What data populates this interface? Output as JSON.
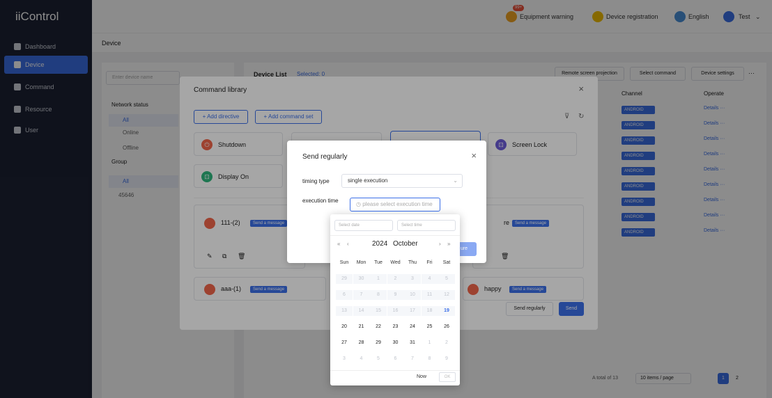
{
  "app": {
    "logo": "iiControl"
  },
  "sidebar": {
    "items": [
      {
        "label": "Dashboard"
      },
      {
        "label": "Device"
      },
      {
        "label": "Command"
      },
      {
        "label": "Resource"
      },
      {
        "label": "User"
      }
    ]
  },
  "topbar": {
    "warning_badge": "99+",
    "equipment_warning": "Equipment warning",
    "device_registration": "Device registration",
    "language": "English",
    "user": "Test"
  },
  "breadcrumb": "Device",
  "left_panel": {
    "search_placeholder": "Enter device name",
    "network_status_title": "Network status",
    "network_options": [
      "All",
      "Online",
      "Offline"
    ],
    "group_title": "Group",
    "group_options": [
      "All",
      "45646"
    ]
  },
  "device_list": {
    "title": "Device List",
    "selected": "Selected: 0",
    "actions": [
      "Remote screen projection",
      "Select command",
      "Device settings",
      "···"
    ],
    "columns": {
      "channel": "Channel",
      "operate": "Operate"
    },
    "channel_value": "ANDROID",
    "details": "Details",
    "more": "···",
    "rows": 9
  },
  "pagination": {
    "total": "A total of 13",
    "per_page": "10 items / page",
    "pages": [
      "1",
      "2"
    ]
  },
  "command_library": {
    "title": "Command library",
    "add_directive": "+ Add directive",
    "add_command_set": "+ Add command set",
    "commands": [
      {
        "label": "Shutdown",
        "color": "#f2664b"
      },
      {
        "label": "Screen Lock",
        "color": "#6b5bd6"
      },
      {
        "label": "Display On",
        "color": "#2fb67d"
      }
    ],
    "sets": [
      {
        "label": "111-(2)",
        "action": "Send a message"
      },
      {
        "label": "re",
        "action": "Send a message"
      },
      {
        "label": "aaa-(1)",
        "action": "Send a message"
      },
      {
        "label": "happy",
        "action": "Send a message"
      }
    ],
    "send_regularly_btn": "Send regularly",
    "send_btn": "Send"
  },
  "send_dialog": {
    "title": "Send regularly",
    "timing_label": "timing type",
    "timing_value": "single execution",
    "exec_label": "execution time",
    "exec_placeholder": "please select execution time",
    "confirm_partial": "ure"
  },
  "date_picker": {
    "date_placeholder": "Select date",
    "time_placeholder": "Select time",
    "year": "2024",
    "month": "October",
    "weekdays": [
      "Sun",
      "Mon",
      "Tue",
      "Wed",
      "Thu",
      "Fri",
      "Sat"
    ],
    "weeks": [
      [
        "29",
        "30",
        "1",
        "2",
        "3",
        "4",
        "5"
      ],
      [
        "6",
        "7",
        "8",
        "9",
        "10",
        "11",
        "12"
      ],
      [
        "13",
        "14",
        "15",
        "16",
        "17",
        "18",
        "19"
      ],
      [
        "20",
        "21",
        "22",
        "23",
        "24",
        "25",
        "26"
      ],
      [
        "27",
        "28",
        "29",
        "30",
        "31",
        "1",
        "2"
      ],
      [
        "3",
        "4",
        "5",
        "6",
        "7",
        "8",
        "9"
      ]
    ],
    "today": "19",
    "now_btn": "Now",
    "ok_btn": "OK"
  },
  "colors": {
    "accent": "#3b6fe8",
    "sidebar": "#1d2234",
    "warning": "#f5a623"
  }
}
